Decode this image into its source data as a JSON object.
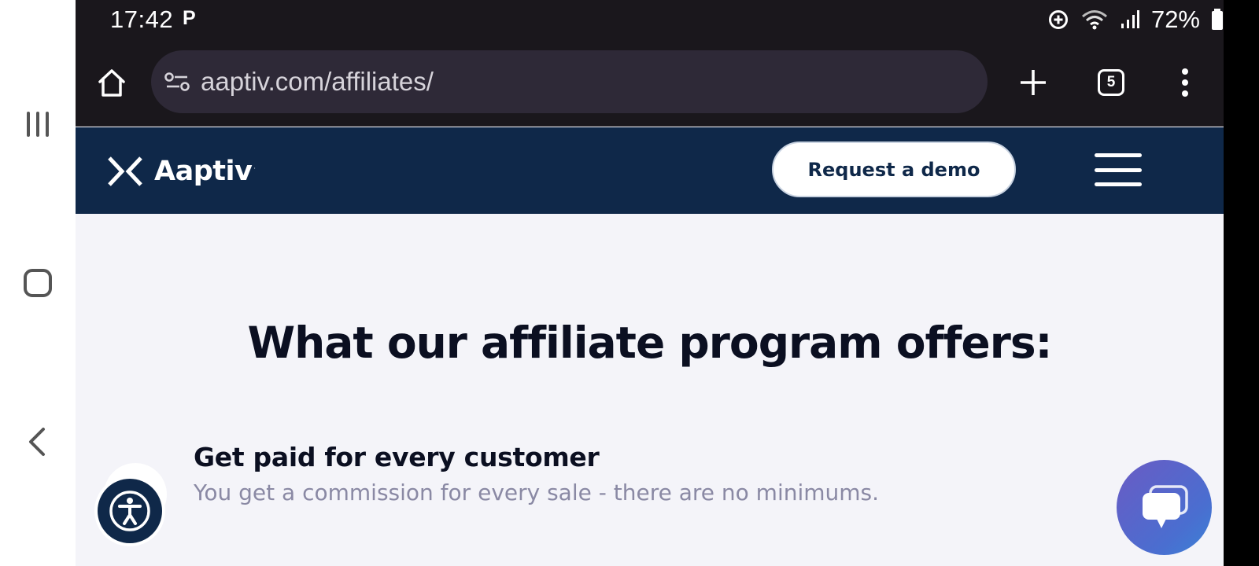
{
  "status_bar": {
    "time": "17:42",
    "notification_glyph": "P",
    "battery_percent": "72%",
    "icons": [
      "data-saver-icon",
      "wifi-icon",
      "signal-icon",
      "battery-icon"
    ]
  },
  "browser": {
    "url": "aaptiv.com/affiliates/",
    "tab_count": "5",
    "icons": [
      "home-icon",
      "site-info-icon",
      "plus-icon",
      "tabs-icon",
      "more-vert-icon"
    ]
  },
  "site_header": {
    "brand_name": "Aaptiv",
    "brand_tm": "·",
    "demo_button_label": "Request a demo",
    "background": "#0f2849"
  },
  "content": {
    "heading": "What our affiliate program offers:",
    "feature": {
      "title": "Get paid for every customer",
      "description": "You get a commission for every sale - there are no minimums."
    }
  },
  "widgets": {
    "accessibility_icon": "accessibility-icon",
    "chat_icon": "chat-icon"
  },
  "colors": {
    "browser_chrome": "#1a171c",
    "page_background": "#f4f4f9",
    "heading_text": "#0b0f21",
    "muted_text": "#8a89a4"
  }
}
